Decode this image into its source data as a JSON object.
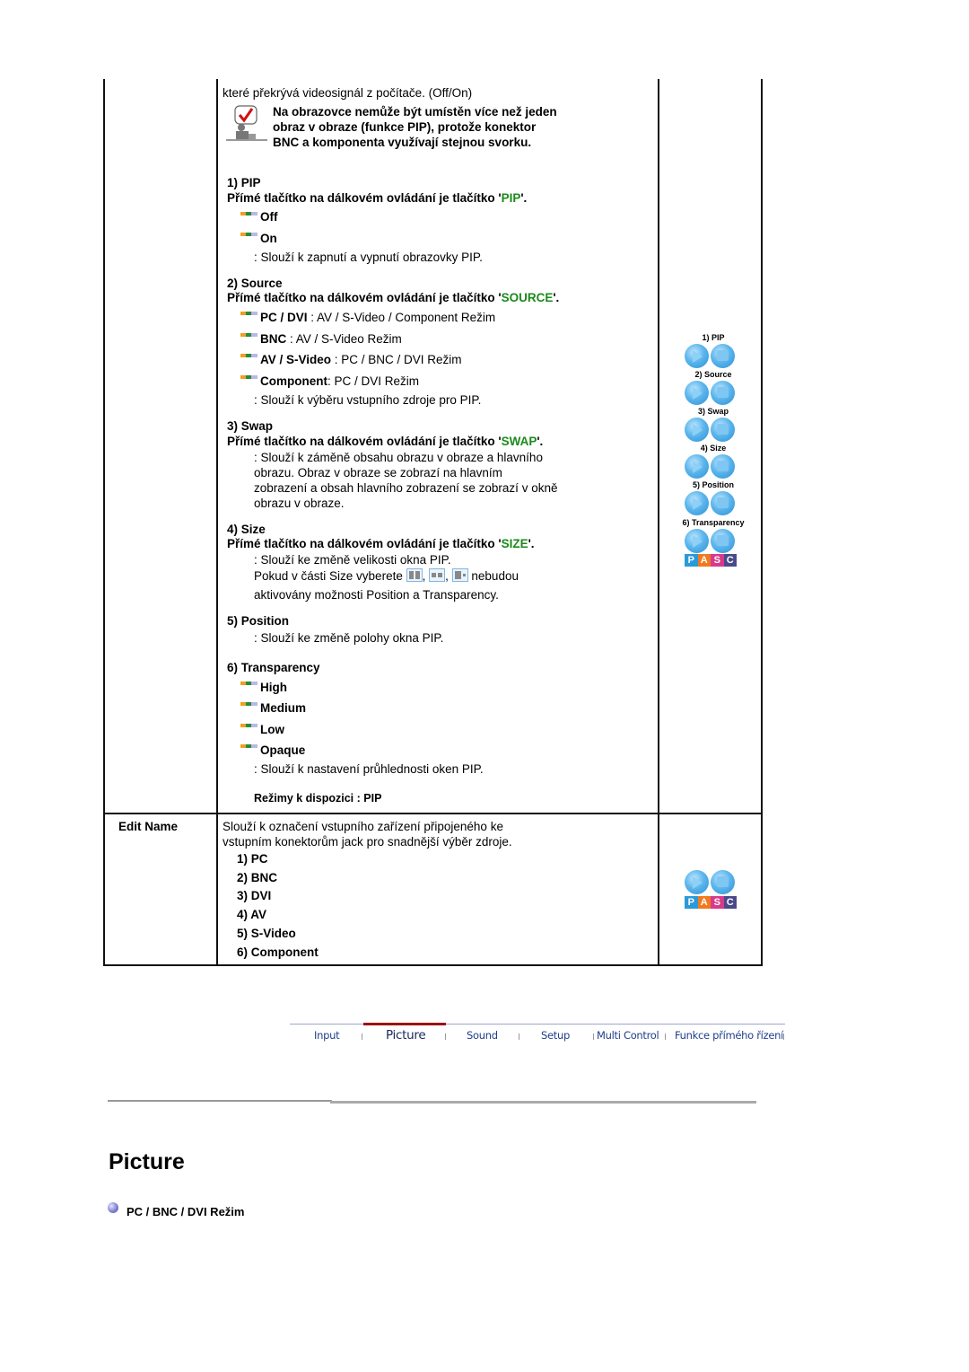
{
  "pip_row": {
    "intro": "které překrývá videosignál z počítače. (Off/On)",
    "note": [
      "Na obrazovce nemůže být umístěn více než jeden",
      "obraz v obraze (funkce PIP), protože konektor",
      "BNC a komponenta využívají stejnou svorku."
    ],
    "sections": {
      "pip": {
        "title": "1) PIP",
        "direct_prefix": "Přímé tlačítko na dálkovém ovládání je tlačítko '",
        "direct_key": "PIP",
        "direct_suffix": "'.",
        "options": [
          "Off",
          "On"
        ],
        "desc": ": Slouží k zapnutí a vypnutí obrazovky PIP."
      },
      "source": {
        "title": "2) Source",
        "direct_prefix": "Přímé tlačítko na dálkovém ovládání je tlačítko '",
        "direct_key": "SOURCE",
        "direct_suffix": "'.",
        "options": [
          {
            "label": "PC / DVI",
            "value": " : AV / S-Video / Component Režim"
          },
          {
            "label": "BNC",
            "value": " : AV / S-Video Režim"
          },
          {
            "label": "AV / S-Video",
            "value": " : PC / BNC / DVI Režim"
          },
          {
            "label": "Component",
            "value": ": PC / DVI Režim"
          }
        ],
        "desc": ": Slouží k výběru vstupního zdroje pro PIP."
      },
      "swap": {
        "title": "3) Swap",
        "direct_prefix": "Přímé tlačítko na dálkovém ovládání je tlačítko '",
        "direct_key": "SWAP",
        "direct_suffix": "'.",
        "desc": [
          ": Slouží k záměně obsahu obrazu v obraze a hlavního",
          "obrazu. Obraz v obraze se zobrazí na hlavním",
          "zobrazení a obsah hlavního zobrazení se zobrazí v okně",
          "obrazu v obraze."
        ]
      },
      "size": {
        "title": "4) Size",
        "direct_prefix": "Přímé tlačítko na dálkovém ovládání je tlačítko '",
        "direct_key": "SIZE",
        "direct_suffix": "'.",
        "desc1": ": Slouží ke změně velikosti okna PIP.",
        "desc2_prefix": "Pokud v části Size vyberete ",
        "desc2_sep": ",",
        "desc2_suffix": " nebudou",
        "desc3": "aktivovány možnosti Position a Transparency."
      },
      "position": {
        "title": "5) Position",
        "desc": ": Slouží ke změně polohy okna PIP."
      },
      "transparency": {
        "title": "6) Transparency",
        "options": [
          "High",
          "Medium",
          "Low",
          "Opaque"
        ],
        "desc": ": Slouží k nastavení průhlednosti oken PIP."
      }
    },
    "modes": "Režimy k dispozici : PIP",
    "remote_labels": [
      "1) PIP",
      "2) Source",
      "3) Swap",
      "4) Size",
      "5) Position",
      "6) Transparency"
    ],
    "pasc": [
      "P",
      "A",
      "S",
      "C"
    ]
  },
  "edit_name_row": {
    "label": "Edit Name",
    "desc": [
      "Slouží k označení vstupního zařízení připojeného ke",
      "vstupním konektorům jack pro snadnější výběr zdroje."
    ],
    "items": [
      "1) PC",
      "2) BNC",
      "3) DVI",
      "4) AV",
      "5) S-Video",
      "6) Component"
    ]
  },
  "nav": {
    "tabs": [
      "Input",
      "Picture",
      "Sound",
      "Setup",
      "Multi Control",
      "Funkce přímého řízení"
    ],
    "active": "Picture"
  },
  "colors": {
    "accent_green": "#1a8a1a",
    "nav_active": "#a01010",
    "pasc": [
      "#2a9ad8",
      "#f07a20",
      "#d83a8a",
      "#4a4a8a"
    ]
  },
  "section": {
    "title": "Picture",
    "subtitle": "PC / BNC / DVI Režim"
  }
}
